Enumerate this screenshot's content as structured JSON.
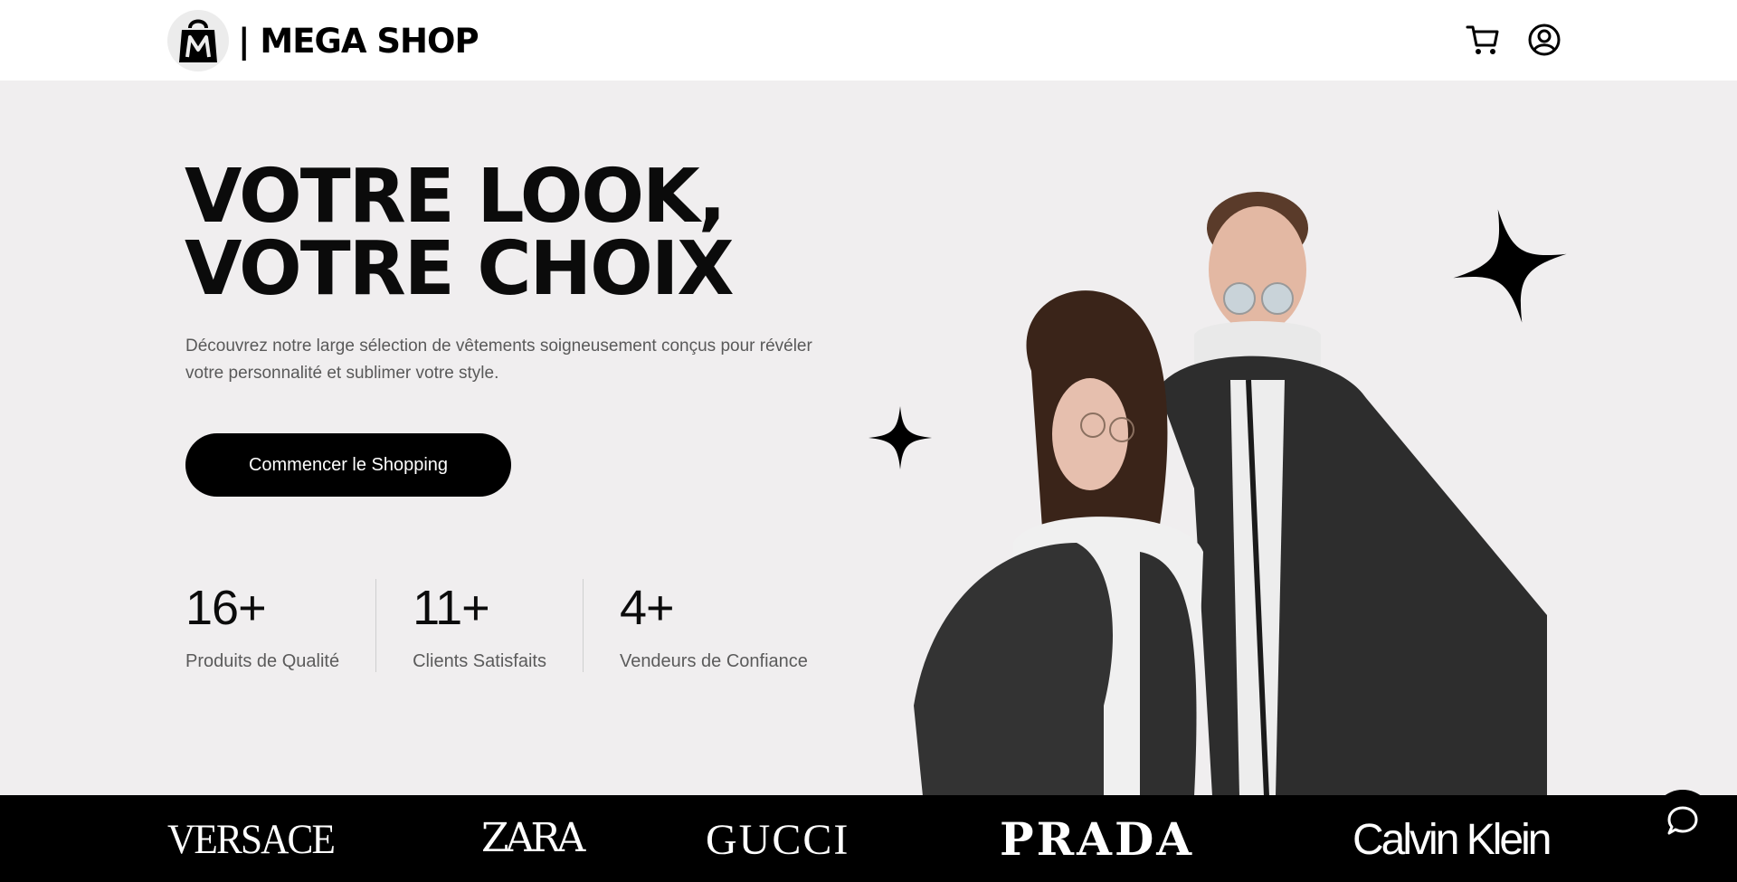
{
  "header": {
    "logo_text": "| MEGA SHOP",
    "cart_icon": "cart-icon",
    "account_icon": "user-circle-icon"
  },
  "hero": {
    "title_line1": "VOTRE LOOK,",
    "title_line2": "VOTRE CHOIX",
    "description": "Découvrez notre large sélection de vêtements soigneusement conçus pour révéler votre personnalité et sublimer votre style.",
    "cta_label": "Commencer le Shopping",
    "image": "couple-in-denim-jackets-photo"
  },
  "stats": [
    {
      "value": "16+",
      "label": "Produits de Qualité"
    },
    {
      "value": "11+",
      "label": "Clients Satisfaits"
    },
    {
      "value": "4+",
      "label": "Vendeurs de Confiance"
    }
  ],
  "brands": [
    "VERSACE",
    "ZARA",
    "GUCCI",
    "PRADA",
    "Calvin Klein"
  ],
  "chat": {
    "icon": "chat-bubble-icon"
  },
  "colors": {
    "background": "#f0eeef",
    "header_bg": "#ffffff",
    "primary": "#000000",
    "text_muted": "#595959"
  }
}
